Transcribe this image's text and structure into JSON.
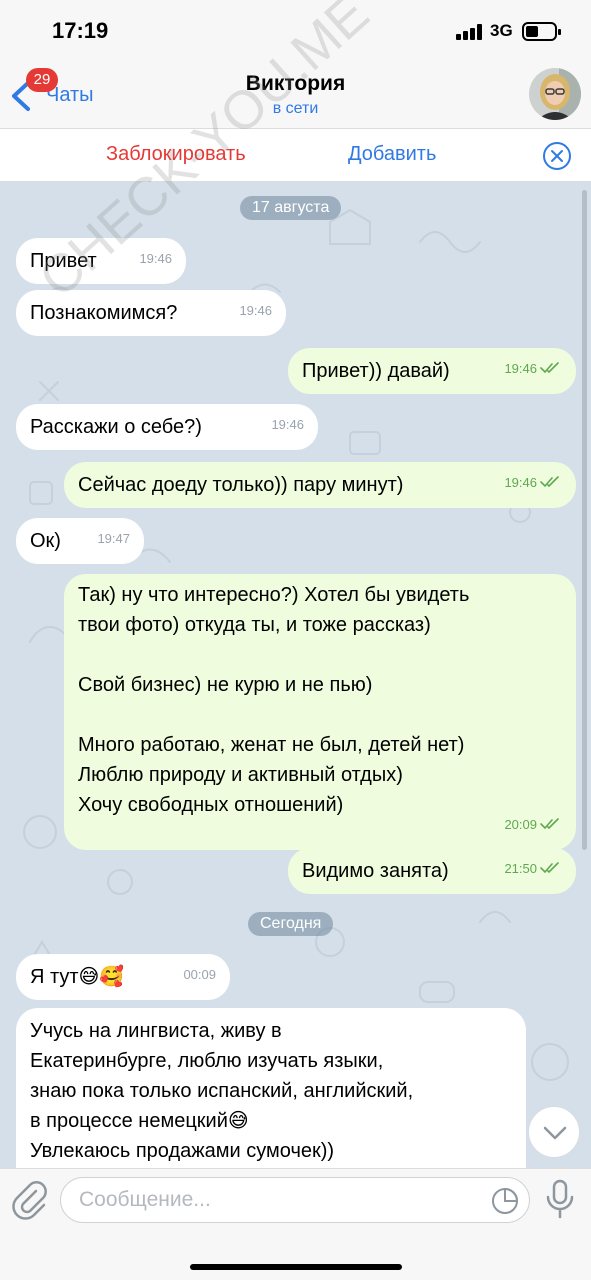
{
  "status_bar": {
    "time": "17:19",
    "network": "3G"
  },
  "nav": {
    "back_label": "Чаты",
    "unread_badge": "29",
    "contact_name": "Виктория",
    "contact_status": "в сети"
  },
  "actions": {
    "block_label": "Заблокировать",
    "add_label": "Добавить"
  },
  "chat": {
    "dates": [
      "17 августа",
      "Сегодня"
    ],
    "messages": [
      {
        "dir": "in",
        "text": "Привет",
        "time": "19:46"
      },
      {
        "dir": "in",
        "text": "Познакомимся?",
        "time": "19:46"
      },
      {
        "dir": "out",
        "text": "Привет)) давай)",
        "time": "19:46"
      },
      {
        "dir": "in",
        "text": "Расскажи о себе?)",
        "time": "19:46"
      },
      {
        "dir": "out",
        "text": "Сейчас доеду только)) пару минут)",
        "time": "19:46"
      },
      {
        "dir": "in",
        "text": "Ок)",
        "time": "19:47"
      },
      {
        "dir": "out",
        "text": "Так) ну что интересно?) Хотел бы увидеть\nтвои фото) откуда ты, и тоже рассказ)\n\nСвой бизнес) не курю и не пью)\n\nМного работаю, женат не был, детей нет)\nЛюблю природу и активный отдых)\nХочу свободных отношений)",
        "time": "20:09"
      },
      {
        "dir": "out",
        "text": "Видимо занята)",
        "time": "21:50"
      },
      {
        "dir": "in",
        "text": "Я тут😅🥰",
        "time": "00:09"
      },
      {
        "dir": "in",
        "text": "Учусь на лингвиста, живу в\nЕкатеринбурге, люблю изучать языки,\nзнаю пока только испанский, английский,\nв процессе немецкий😅\nУвлекаюсь продажами сумочек))",
        "time": ""
      }
    ]
  },
  "input": {
    "placeholder": "Сообщение..."
  },
  "watermark_text": "CHECK-YOU.ME",
  "colors": {
    "accent": "#2f7ae5",
    "danger": "#e53935",
    "outgoing_bubble": "#effdde",
    "chat_bg": "#d5dfe9",
    "read_checks": "#5fa84f"
  }
}
